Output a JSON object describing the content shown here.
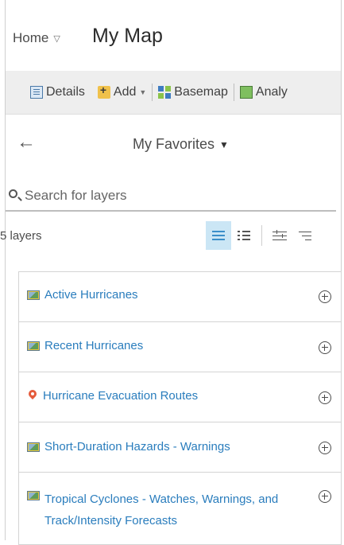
{
  "header": {
    "home_label": "Home",
    "map_title": "My Map"
  },
  "toolbar": {
    "details_label": "Details",
    "add_label": "Add",
    "basemap_label": "Basemap",
    "analysis_label": "Analy"
  },
  "panel": {
    "title": "My Favorites"
  },
  "search": {
    "placeholder": "Search for layers",
    "value": ""
  },
  "layers": {
    "count_label": "5 layers",
    "items": [
      {
        "label": "Active Hurricanes",
        "icon": "feature-layer-icon"
      },
      {
        "label": "Recent Hurricanes",
        "icon": "feature-layer-icon"
      },
      {
        "label": "Hurricane Evacuation Routes",
        "icon": "map-pin-icon"
      },
      {
        "label": "Short-Duration Hazards - Warnings",
        "icon": "feature-layer-icon"
      },
      {
        "label": "Tropical Cyclones - Watches, Warnings, and Track/Intensity Forecasts",
        "icon": "feature-layer-icon"
      }
    ]
  },
  "colors": {
    "link": "#2a7dbd",
    "active_view_bg": "#cbe6f5",
    "toolbar_bg": "#eeeeee"
  }
}
